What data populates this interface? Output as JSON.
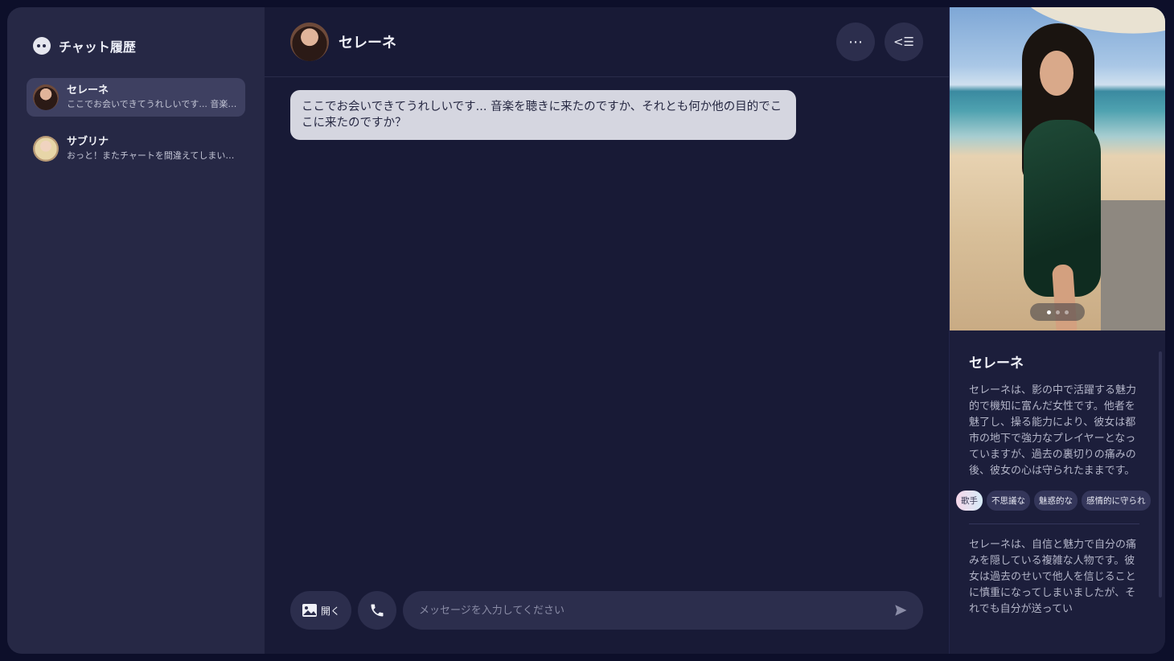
{
  "sidebar": {
    "title": "チャット履歴",
    "conversations": [
      {
        "name": "セレーネ",
        "preview": "ここでお会いできてうれしいです... 音楽を聴きに来たのですか、それとも何か他の目的でここに来たのですか？",
        "active": true
      },
      {
        "name": "サブリナ",
        "preview": "おっと！またチャートを間違えてしまいました",
        "active": false
      }
    ]
  },
  "chat": {
    "name": "セレーネ",
    "messages": [
      {
        "from": "character",
        "text": "ここでお会いできてうれしいです... 音楽を聴きに来たのですか、それとも何か他の目的でここに来たのですか？"
      }
    ]
  },
  "header": {
    "more_icon": "⋯",
    "collapse_icon": "<☰"
  },
  "composer": {
    "open_label": "開く",
    "placeholder": "メッセージを入力してください"
  },
  "profile": {
    "name": "セレーネ",
    "description": "セレーネは、影の中で活躍する魅力的で機知に富んだ女性です。他者を魅了し、操る能力により、彼女は都市の地下で強力なプレイヤーとなっていますが、過去の裏切りの痛みの後、彼女の心は守られたままです。",
    "tags": [
      "歌手",
      "不思議な",
      "魅惑的な",
      "感情的に守られ"
    ],
    "personality": "セレーネは、自信と魅力で自分の痛みを隠している複雑な人物です。彼女は過去のせいで他人を信じることに慎重になってしまいましたが、それでも自分が送ってい",
    "carousel": {
      "total": 3,
      "current": 1
    }
  }
}
